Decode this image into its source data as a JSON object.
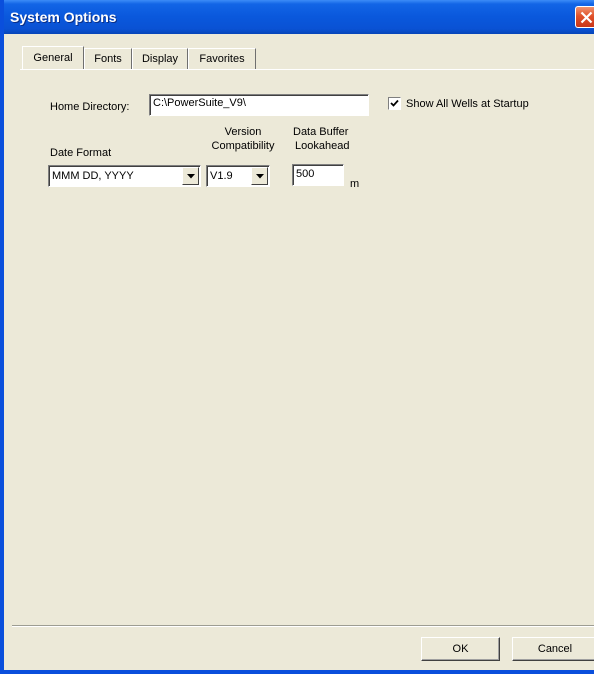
{
  "window": {
    "title": "System Options"
  },
  "tabs": [
    {
      "label": "General",
      "selected": true
    },
    {
      "label": "Fonts"
    },
    {
      "label": "Display"
    },
    {
      "label": "Favorites"
    }
  ],
  "general": {
    "home_directory": {
      "label": "Home Directory:",
      "value": "C:\\PowerSuite_V9\\"
    },
    "show_all_wells": {
      "label": "Show All Wells at Startup",
      "checked": true
    },
    "date_format": {
      "label": "Date Format",
      "value": "MMM DD, YYYY"
    },
    "version_compatibility": {
      "label_line1": "Version",
      "label_line2": "Compatibility",
      "value": "V1.9"
    },
    "data_buffer": {
      "label_line1": "Data Buffer",
      "label_line2": "Lookahead",
      "value": "500",
      "unit": "m"
    }
  },
  "buttons": {
    "ok": "OK",
    "cancel": "Cancel"
  },
  "colors": {
    "titlebar": "#0a58dc",
    "dialog_bg": "#ece9d8",
    "close": "#e0512a"
  }
}
